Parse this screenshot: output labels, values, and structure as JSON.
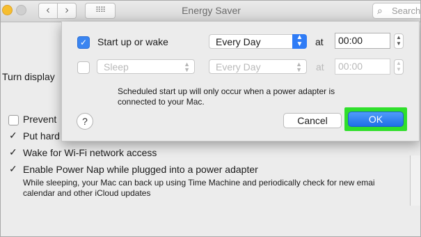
{
  "window": {
    "title": "Energy Saver",
    "search_placeholder": "Search"
  },
  "toolbar": {
    "back_glyph": "‹",
    "forward_glyph": "›",
    "grid_glyph": "⠿⠿"
  },
  "background_pane": {
    "turn_display_label": "Turn display",
    "options": [
      {
        "label": "Prevent",
        "checked": false
      },
      {
        "label": "Put hard",
        "checked": true
      },
      {
        "label": "Wake for Wi-Fi network access",
        "checked": true
      },
      {
        "label": "Enable Power Nap while plugged into a power adapter",
        "checked": true
      }
    ],
    "power_nap_description": [
      "While sleeping, your Mac can back up using Time Machine and periodically check for new emai",
      "calendar and other iCloud updates"
    ]
  },
  "schedule_sheet": {
    "row1": {
      "checked": true,
      "label": "Start up or wake",
      "frequency": "Every Day",
      "at_label": "at",
      "time": "00:00"
    },
    "row2": {
      "checked": false,
      "action": "Sleep",
      "frequency": "Every Day",
      "at_label": "at",
      "time": "00:00"
    },
    "note": [
      "Scheduled start up will only occur when a power adapter is",
      "connected to your Mac."
    ],
    "help_label": "?",
    "cancel_label": "Cancel",
    "ok_label": "OK"
  },
  "colors": {
    "accent": "#2f7cf6",
    "ok_highlight": "#2fdf2b"
  }
}
